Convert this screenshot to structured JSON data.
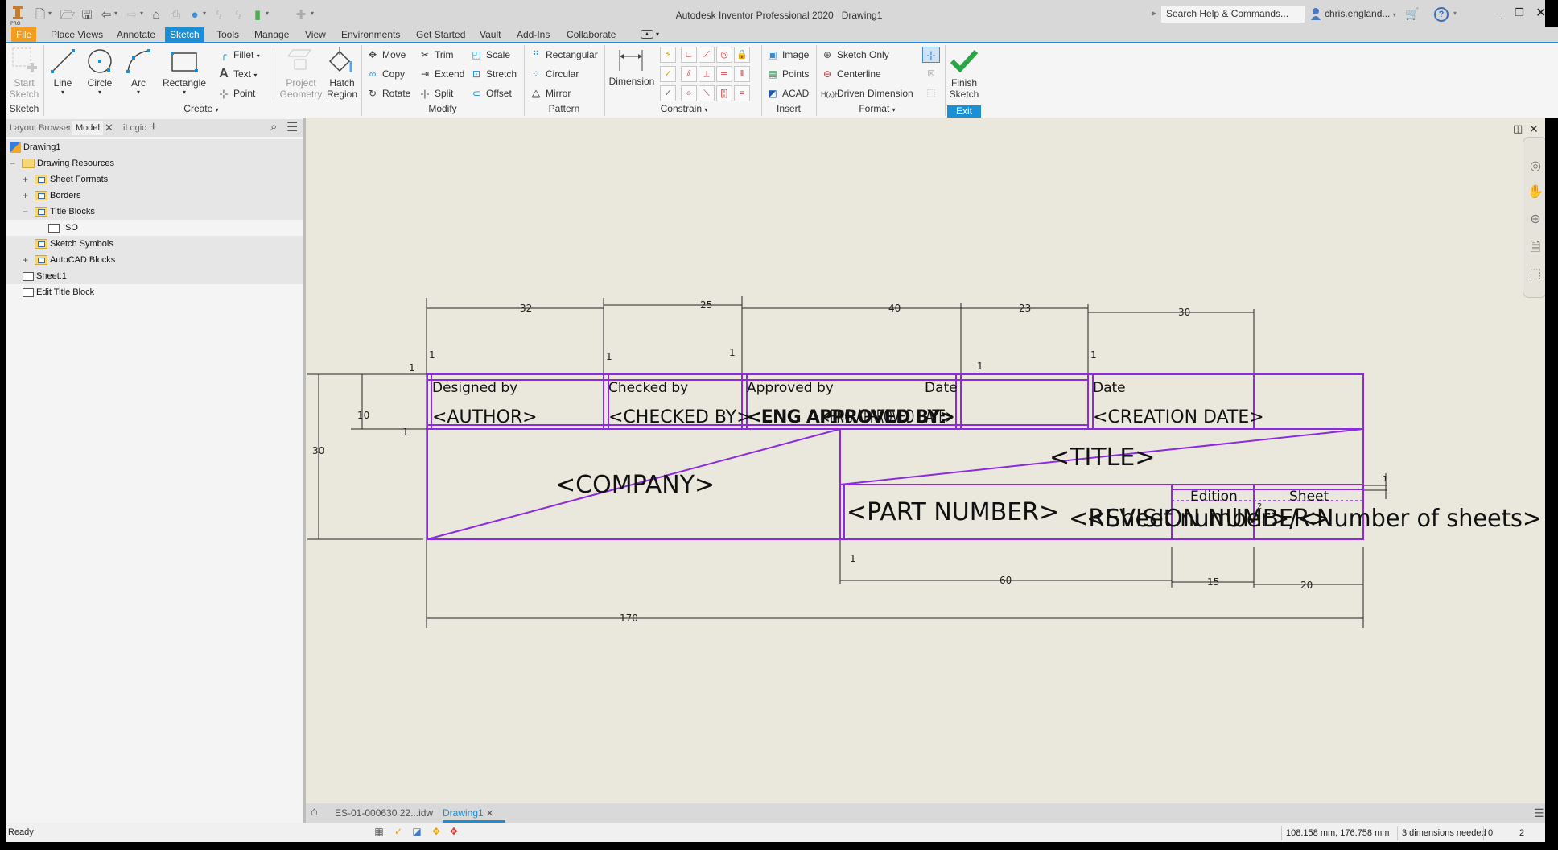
{
  "window": {
    "app_title": "Autodesk Inventor Professional 2020",
    "doc_title": "Drawing1",
    "search_placeholder": "Search Help & Commands...",
    "user": "chris.england...",
    "app_badge": "PRO"
  },
  "menu_tabs": [
    {
      "label": "File",
      "state": "file"
    },
    {
      "label": "Place Views",
      "state": ""
    },
    {
      "label": "Annotate",
      "state": ""
    },
    {
      "label": "Sketch",
      "state": "active"
    },
    {
      "label": "Tools",
      "state": ""
    },
    {
      "label": "Manage",
      "state": ""
    },
    {
      "label": "View",
      "state": ""
    },
    {
      "label": "Environments",
      "state": ""
    },
    {
      "label": "Get Started",
      "state": ""
    },
    {
      "label": "Vault",
      "state": ""
    },
    {
      "label": "Add-Ins",
      "state": ""
    },
    {
      "label": "Collaborate",
      "state": ""
    }
  ],
  "ribbon": {
    "sketch_panel": {
      "start_sketch": "Start\nSketch",
      "start_sketch_1": "Start",
      "start_sketch_2": "Sketch",
      "panel": "Sketch"
    },
    "create_panel": {
      "line": "Line",
      "circle": "Circle",
      "arc": "Arc",
      "rectangle": "Rectangle",
      "fillet": "Fillet",
      "text": "Text",
      "point": "Point",
      "project_1": "Project",
      "project_2": "Geometry",
      "hatch_1": "Hatch",
      "hatch_2": "Region",
      "panel": "Create"
    },
    "modify_panel": {
      "move": "Move",
      "copy": "Copy",
      "rotate": "Rotate",
      "trim": "Trim",
      "extend": "Extend",
      "split": "Split",
      "scale": "Scale",
      "stretch": "Stretch",
      "offset": "Offset",
      "panel": "Modify"
    },
    "pattern_panel": {
      "rectangular": "Rectangular",
      "circular": "Circular",
      "mirror": "Mirror",
      "panel": "Pattern"
    },
    "constrain_panel": {
      "dimension": "Dimension",
      "panel": "Constrain"
    },
    "insert_panel": {
      "image": "Image",
      "points": "Points",
      "acad": "ACAD",
      "panel": "Insert"
    },
    "format_panel": {
      "sketch_only": "Sketch Only",
      "centerline": "Centerline",
      "driven_dimension": "Driven Dimension",
      "panel": "Format"
    },
    "exit_panel": {
      "finish_1": "Finish",
      "finish_2": "Sketch",
      "panel": "Exit"
    }
  },
  "browser": {
    "tabs": [
      "Layout Browser",
      "Model",
      "iLogic"
    ],
    "tree": [
      {
        "label": "Drawing1",
        "level": 0,
        "exp": ""
      },
      {
        "label": "Drawing Resources",
        "level": 1,
        "exp": "−"
      },
      {
        "label": "Sheet Formats",
        "level": 2,
        "exp": "+"
      },
      {
        "label": "Borders",
        "level": 2,
        "exp": "+"
      },
      {
        "label": "Title Blocks",
        "level": 2,
        "exp": "−"
      },
      {
        "label": "ISO",
        "level": 3,
        "exp": ""
      },
      {
        "label": "Sketch Symbols",
        "level": 2,
        "exp": ""
      },
      {
        "label": "AutoCAD Blocks",
        "level": 2,
        "exp": "+"
      },
      {
        "label": "Sheet:1",
        "level": 1,
        "exp": ""
      },
      {
        "label": "Edit Title Block",
        "level": 1,
        "exp": ""
      }
    ]
  },
  "title_block": {
    "labels": {
      "designed_by": "Designed by",
      "checked_by": "Checked by",
      "approved_by": "Approved by",
      "date1": "Date",
      "date2": "Date",
      "edition": "Edition",
      "sheet": "Sheet"
    },
    "fields": {
      "author": "<AUTHOR>",
      "checked_by": "<CHECKED BY>",
      "eng_approved_by": "<ENG APPROVED BY>",
      "eng_approved_date": "<ENG APPROVED DATE>",
      "creation_date": "<CREATION DATE>",
      "company": "<COMPANY>",
      "title": "<TITLE>",
      "part_number": "<PART NUMBER>",
      "revision_number": "<REVISION NUMBER>",
      "sheet_number": "<Sheet number>/<Number of sheets>"
    },
    "dimensions": {
      "col1": "32",
      "col2": "25",
      "col3": "40",
      "col4": "23",
      "col5": "30",
      "part_w": "60",
      "edition_w": "15",
      "sheet_w": "20",
      "total_w": "170",
      "total_h": "30",
      "row_h": "10",
      "offset": "1",
      "offset2": "2"
    }
  },
  "doc_tabs": [
    {
      "label": "ES-01-000630 22...idw",
      "active": false
    },
    {
      "label": "Drawing1",
      "active": true
    }
  ],
  "status": {
    "ready": "Ready",
    "coords": "108.158 mm, 176.758 mm",
    "dims_needed": "3 dimensions needed",
    "count1": "0",
    "count2": "2"
  },
  "colors": {
    "sketch_line": "#8a2be2",
    "canvas_bg": "#eae8dc",
    "accent": "#1a8fd6",
    "file_tab": "#f39c1f"
  }
}
